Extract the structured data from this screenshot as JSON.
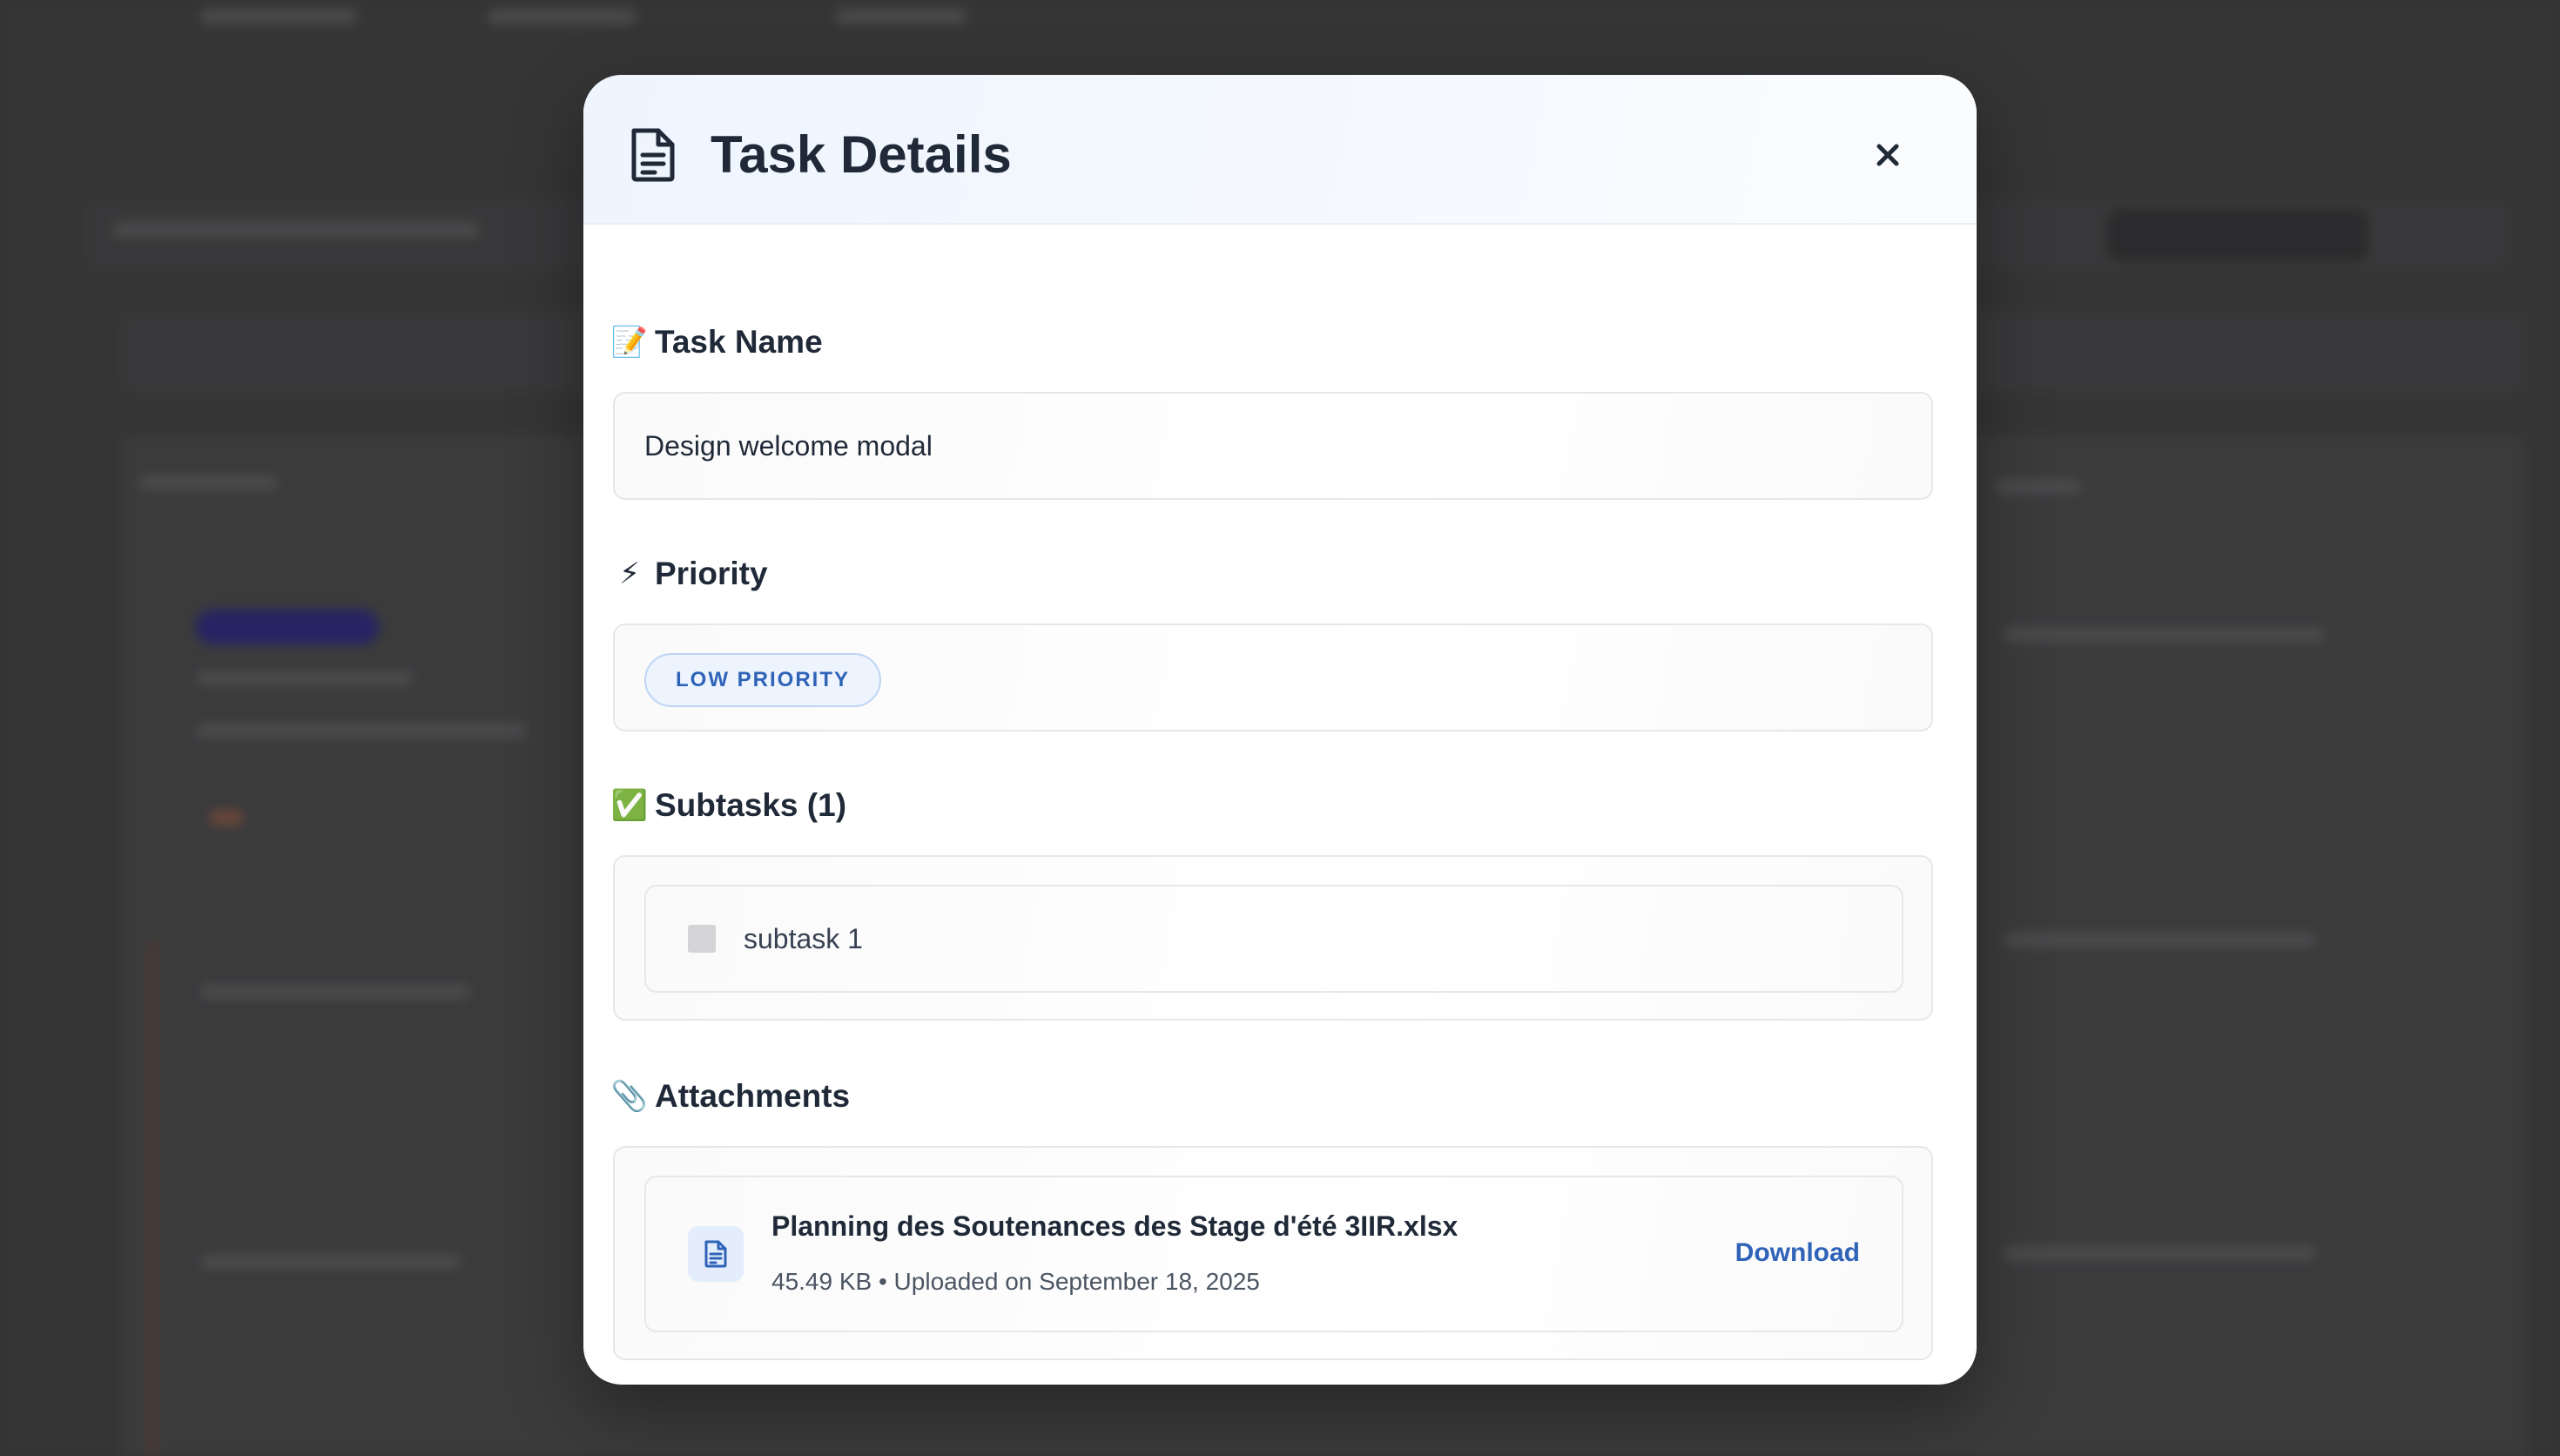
{
  "modal": {
    "title": "Task Details",
    "close_label": "×"
  },
  "task_name": {
    "emoji": "📝",
    "label": "Task Name",
    "value": "Design welcome modal"
  },
  "priority": {
    "emoji": "⚡",
    "label": "Priority",
    "badge": "LOW PRIORITY"
  },
  "subtasks": {
    "emoji": "✅",
    "label": "Subtasks (1)",
    "items": [
      {
        "text": "subtask 1",
        "done": false
      }
    ]
  },
  "attachments": {
    "emoji": "📎",
    "label": "Attachments",
    "items": [
      {
        "file_name": "Planning des Soutenances des Stage d'été 3IIR.xlsx",
        "meta": "45.49 KB • Uploaded on September 18, 2025",
        "action": "Download",
        "icon": "file-text-icon"
      }
    ]
  },
  "colors": {
    "accent": "#2f63b8",
    "badge_bg": "#eef4fd",
    "title": "#1f2937"
  }
}
